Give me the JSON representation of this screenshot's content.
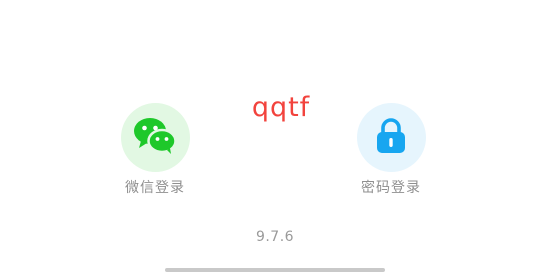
{
  "login": {
    "center_text": "qqtf",
    "options": [
      {
        "label": "微信登录",
        "icon": "wechat-icon",
        "color": "#1ec82a"
      },
      {
        "label": "密码登录",
        "icon": "lock-icon",
        "color": "#17a6f0"
      }
    ]
  },
  "footer": {
    "version": "9.7.6"
  },
  "colors": {
    "wechat_circle": "#e2f8e3",
    "lock_circle": "#e6f5fd",
    "center_text": "#f2433d",
    "label_text": "#8f8f8f"
  }
}
